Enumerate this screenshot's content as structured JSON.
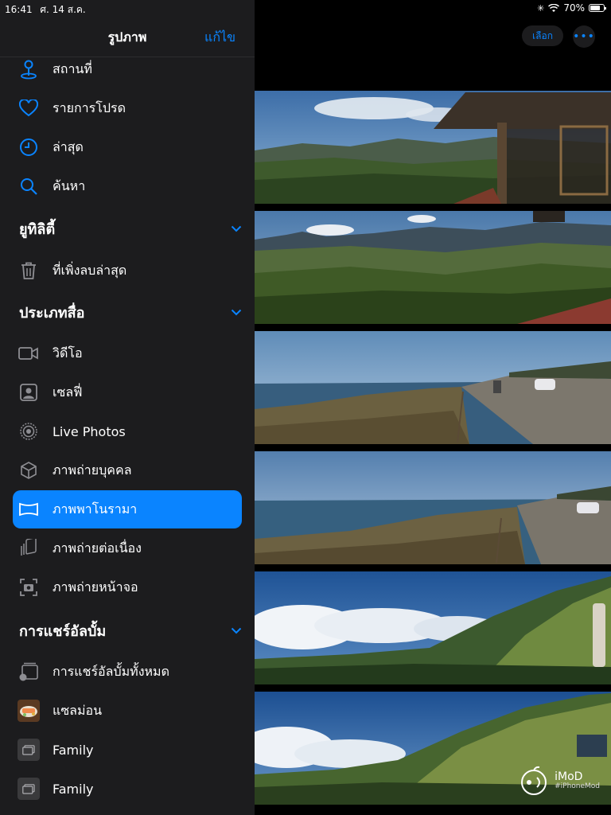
{
  "status": {
    "time": "16:41",
    "date": "ศ. 14 ส.ค.",
    "battery": "70%"
  },
  "sidebar": {
    "title": "รูปภาพ",
    "edit_label": "แก้ไข",
    "items": [
      {
        "label": "สถานที่",
        "icon": "location-pin-icon"
      },
      {
        "label": "รายการโปรด",
        "icon": "heart-icon"
      },
      {
        "label": "ล่าสุด",
        "icon": "clock-icon"
      },
      {
        "label": "ค้นหา",
        "icon": "search-icon"
      }
    ],
    "utilities": {
      "title": "ยูทิลิตี้",
      "items": [
        {
          "label": "ที่เพิ่งลบล่าสุด",
          "icon": "trash-icon"
        }
      ]
    },
    "media_types": {
      "title": "ประเภทสื่อ",
      "items": [
        {
          "label": "วิดีโอ",
          "icon": "video-icon"
        },
        {
          "label": "เซลฟี่",
          "icon": "selfie-icon"
        },
        {
          "label": "Live Photos",
          "icon": "live-photos-icon"
        },
        {
          "label": "ภาพถ่ายบุคคล",
          "icon": "portrait-cube-icon"
        },
        {
          "label": "ภาพพาโนรามา",
          "icon": "panorama-icon",
          "selected": true
        },
        {
          "label": "ภาพถ่ายต่อเนื่อง",
          "icon": "burst-icon"
        },
        {
          "label": "ภาพถ่ายหน้าจอ",
          "icon": "screenshot-icon"
        }
      ]
    },
    "shared_albums": {
      "title": "การแชร์อัลบั้ม",
      "items": [
        {
          "label": "การแชร์อัลบั้มทั้งหมด",
          "icon": "shared-albums-icon"
        },
        {
          "label": "แซลม่อน",
          "icon": "album-thumbnail"
        },
        {
          "label": "Family",
          "icon": "album-placeholder-icon"
        },
        {
          "label": "Family",
          "icon": "album-placeholder-icon"
        }
      ]
    }
  },
  "main": {
    "select_label": "เลือก",
    "more_label": "•••",
    "watermark": {
      "name": "iMoD",
      "handle": "#iPhoneMod"
    }
  },
  "colors": {
    "accent": "#0a84ff",
    "sidebar_bg": "#1c1c1e",
    "background": "#000000"
  }
}
